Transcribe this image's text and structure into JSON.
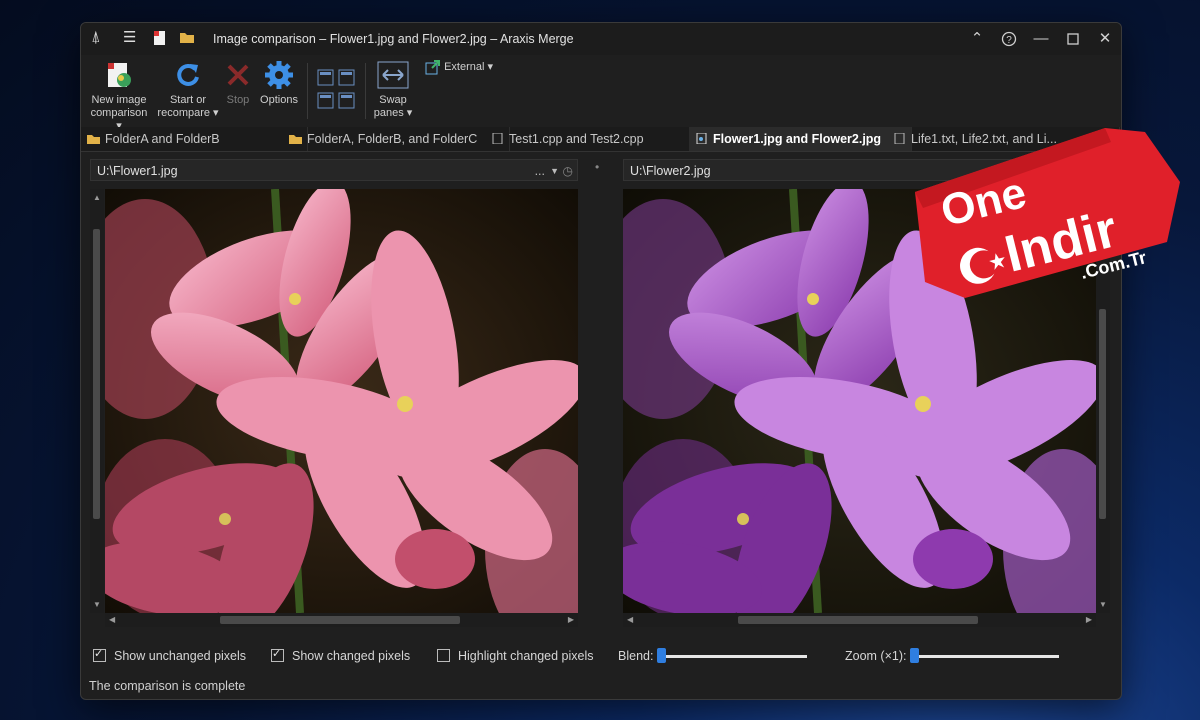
{
  "window": {
    "title": "Image comparison – Flower1.jpg and Flower2.jpg – Araxis Merge"
  },
  "ribbon": {
    "new_image_comparison": [
      "New image",
      "comparison ▾"
    ],
    "start_or_recompare": [
      "Start or",
      "recompare ▾"
    ],
    "stop": "Stop",
    "options": "Options",
    "swap_panes": [
      "Swap",
      "panes ▾"
    ],
    "external": "External ▾"
  },
  "tabs": [
    {
      "label": "FolderA and FolderB"
    },
    {
      "label": "FolderA, FolderB, and FolderC"
    },
    {
      "label": "Test1.cpp and Test2.cpp"
    },
    {
      "label": "Flower1.jpg and Flower2.jpg"
    },
    {
      "label": "Life1.txt, Life2.txt, and Li..."
    }
  ],
  "panes": {
    "left_path": "U:\\Flower1.jpg",
    "right_path": "U:\\Flower2.jpg",
    "path_menu": "...",
    "divider_dot": "•"
  },
  "options": {
    "show_unchanged": "Show unchanged pixels",
    "show_changed": "Show changed pixels",
    "highlight_changed": "Highlight changed pixels",
    "blend": "Blend:",
    "zoom": "Zoom (×1):",
    "show_unchanged_checked": true,
    "show_changed_checked": true,
    "highlight_changed_checked": false,
    "blend_value": 0,
    "zoom_value": 0
  },
  "status": "The comparison is complete",
  "watermark": {
    "line1": "One",
    "line2": "Indir",
    "line3": ".Com.Tr"
  },
  "colors": {
    "accent": "#2f7ee0",
    "watermark_red": "#e0202a"
  }
}
